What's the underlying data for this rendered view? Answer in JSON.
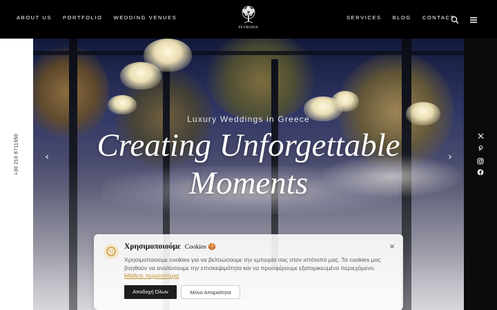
{
  "header": {
    "nav_left": [
      {
        "label": "ABOUT US"
      },
      {
        "label": "PORTFOLIO"
      },
      {
        "label": "WEDDING VENUES"
      }
    ],
    "nav_right": [
      {
        "label": "SERVICES"
      },
      {
        "label": "BLOG"
      },
      {
        "label": "CONTACT"
      }
    ],
    "logo_text": "FEVRONIA",
    "icons": [
      "search-icon",
      "hamburger-menu-icon"
    ]
  },
  "hero": {
    "eyebrow": "Luxury Weddings in Greece",
    "title_line1": "Creating Unforgettable",
    "title_line2": "Moments",
    "prev_arrow": "‹",
    "next_arrow": "›"
  },
  "sidebar_left": {
    "phone": "+30 210 6711950"
  },
  "social": [
    "x-icon",
    "pinterest-icon",
    "instagram-icon",
    "facebook-icon"
  ],
  "cookie_banner": {
    "title_main": "Χρησιμοποιούμε",
    "title_sub": "Cookies 🍪",
    "text": "Χρησιμοποιούμε cookies για να βελτιώσουμε την εμπειρία σας στον ιστότοπό μας. Τα cookies μας βοηθούν να αναλύσουμε την επισκεψιμότητα και να προσφέρουμε εξατομικευμένο περιεχόμενο.",
    "link": "Μάθετε περισσότερα",
    "accept_label": "Αποδοχή Όλων",
    "reject_label": "Μόνο Απαραίτητα",
    "close": "×"
  },
  "colors": {
    "header_bg": "#000000",
    "accent": "#c0902a",
    "button_dark": "#1d1d1d"
  }
}
